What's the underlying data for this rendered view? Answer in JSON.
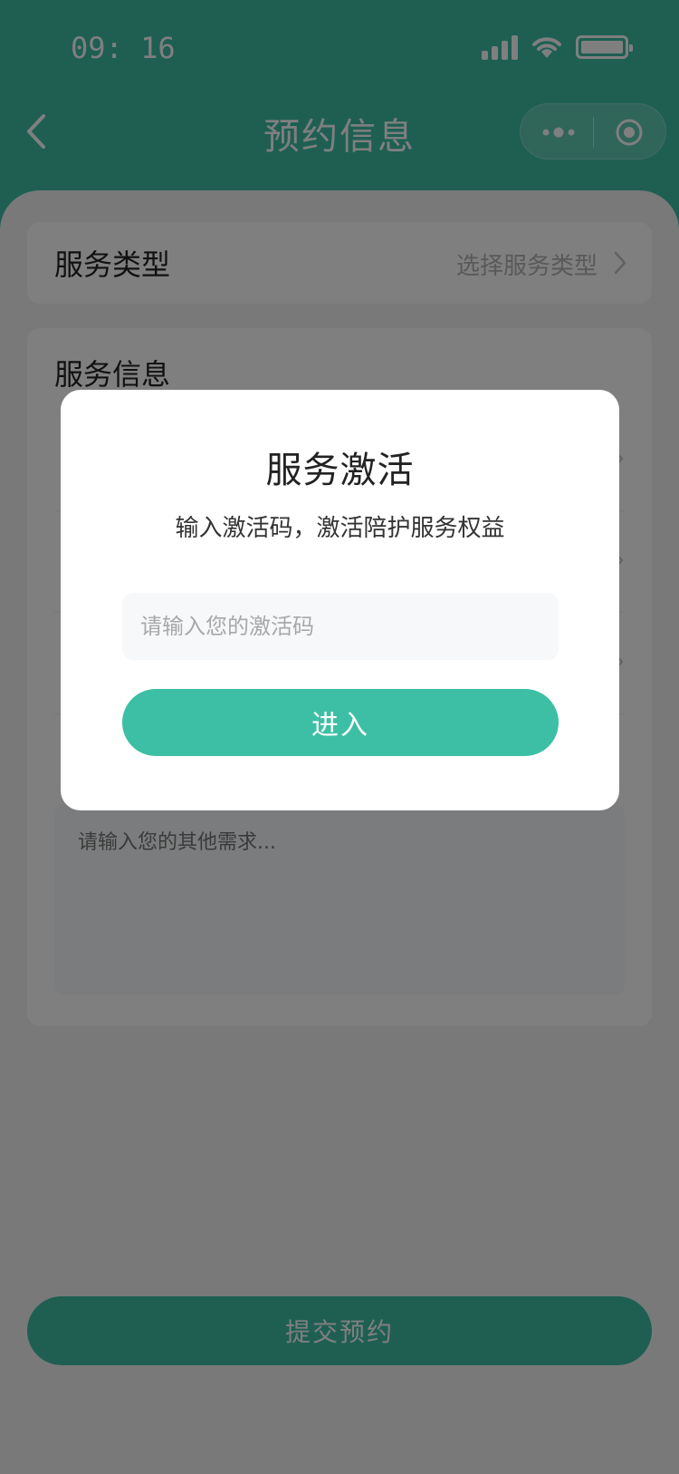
{
  "status_bar": {
    "time": "09: 16"
  },
  "nav": {
    "title": "预约信息"
  },
  "service_type": {
    "label": "服务类型",
    "placeholder": "选择服务类型"
  },
  "service_info": {
    "label": "服务信息",
    "remark_placeholder": "请输入您的其他需求..."
  },
  "submit": {
    "label": "提交预约"
  },
  "modal": {
    "title": "服务激活",
    "subtitle": "输入激活码，激活陪护服务权益",
    "code_placeholder": "请输入您的激活码",
    "enter_label": "进入"
  },
  "colors": {
    "primary": "#3dbfa5",
    "overlay": "rgba(0,0,0,0.5)"
  }
}
